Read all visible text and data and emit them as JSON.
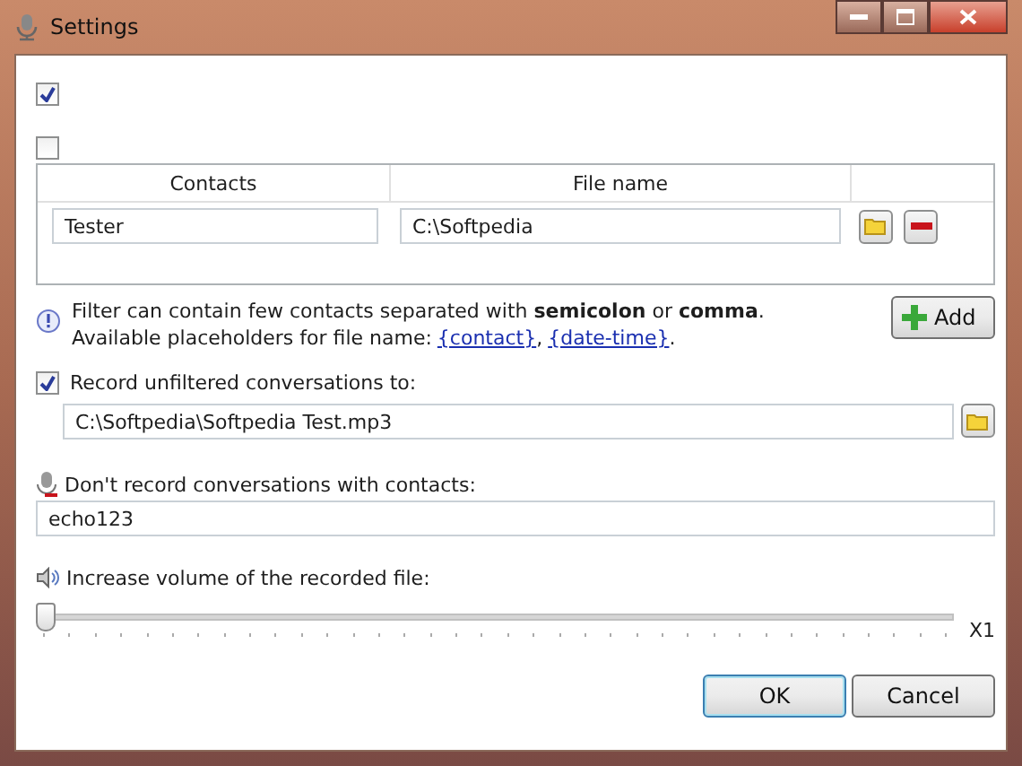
{
  "window": {
    "title": "Settings"
  },
  "options": [
    {
      "checked": true
    },
    {
      "checked": false
    }
  ],
  "table": {
    "columns": [
      "Contacts",
      "File name"
    ],
    "rows": [
      {
        "contact": "Tester",
        "file": "C:\\Softpedia"
      }
    ]
  },
  "info": {
    "line_1": "Filter can contain few contacts separated with **semicolon** or **comma**.",
    "line_2": "Available placeholders for file name:",
    "links": [
      {
        "text": "{contact}",
        "after": ","
      },
      {
        "text": "{date-time}",
        "after": "."
      }
    ]
  },
  "add_button": "Add",
  "unfiltered": {
    "label": "Record unfiltered conversations to:",
    "checked": true,
    "path": "C:\\Softpedia\\Softpedia Test.mp3"
  },
  "exclude": {
    "label": "Don't record conversations with contacts:",
    "value": "echo123"
  },
  "volume": {
    "label": "Increase volume of the recorded file:",
    "level": 0,
    "reading": "X1"
  },
  "buttons": [
    {
      "label": "OK",
      "default": true
    },
    {
      "label": "Cancel",
      "default": false
    }
  ]
}
